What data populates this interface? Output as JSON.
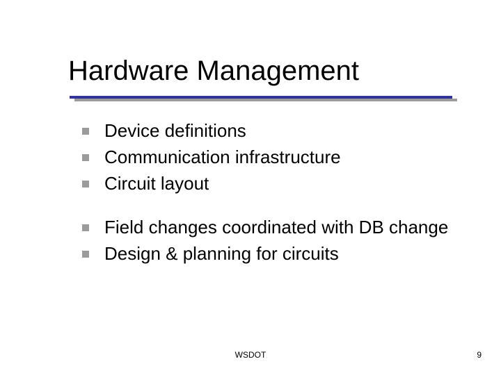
{
  "title": "Hardware Management",
  "groups": [
    {
      "items": [
        {
          "text": "Device definitions"
        },
        {
          "text": "Communication infrastructure"
        },
        {
          "text": "Circuit layout"
        }
      ]
    },
    {
      "items": [
        {
          "text": "Field changes coordinated with DB change"
        },
        {
          "text": "Design & planning for circuits"
        }
      ]
    }
  ],
  "footer": {
    "center": "WSDOT",
    "page": "9"
  }
}
